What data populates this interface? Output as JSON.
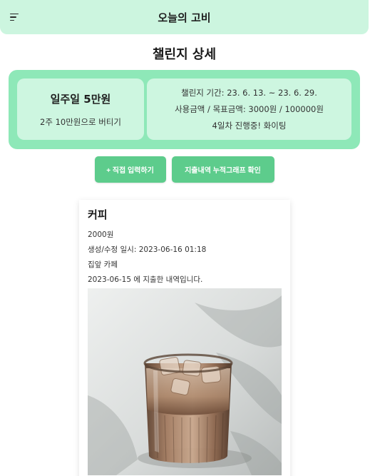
{
  "header": {
    "title": "오늘의 고비"
  },
  "page": {
    "title": "챌린지 상세"
  },
  "challenge": {
    "name": "일주일 5만원",
    "description": "2주 10만원으로 버티기",
    "period": "챌린지 기간: 23. 6. 13. ~ 23. 6. 29.",
    "amounts": "사용금액 / 목표금액: 3000원 / 100000원",
    "status": "4일차 진행중! 화이팅"
  },
  "actions": {
    "direct_input": "+ 직접 입력하기",
    "graph": "지출내역 누적그래프 확인"
  },
  "expense": {
    "title": "커피",
    "amount": "2000원",
    "created": "생성/수정 일시: 2023-06-16 01:18",
    "place": "집앞 카페",
    "spent_on": "2023-06-15 에 지출한 내역입니다."
  },
  "colors": {
    "header_bg": "#ccf5df",
    "card_bg": "#8ee8b8",
    "button": "#5dcc8c"
  }
}
